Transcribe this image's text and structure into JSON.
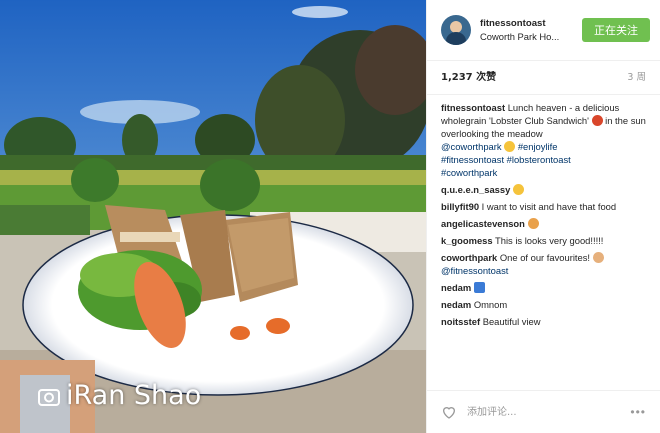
{
  "header": {
    "username": "fitnessontoast",
    "location": "Coworth Park Ho...",
    "follow_label": "正在关注"
  },
  "stats": {
    "likes": "1,237 次赞",
    "time_ago": "3 周"
  },
  "caption": {
    "user": "fitnessontoast",
    "text": "Lunch heaven - a delicious wholegrain 'Lobster Club Sandwich'",
    "text2": "in the sun overlooking the meadow",
    "mention": "@coworthpark",
    "tag1": "#enjoylife",
    "tag2": "#fitnessontoast",
    "tag3": "#lobsterontoast",
    "tag4": "#coworthpark"
  },
  "comments": [
    {
      "user": "q.u.e.e.n_sassy",
      "text": ""
    },
    {
      "user": "billyfit90",
      "text": "I want to visit and have that food"
    },
    {
      "user": "angelicastevenson",
      "text": ""
    },
    {
      "user": "k_goomess",
      "text": "This is looks very good!!!!!"
    },
    {
      "user": "coworthpark",
      "text": "One of our favourites!",
      "mention": "@fitnessontoast"
    },
    {
      "user": "nedam",
      "text": ""
    },
    {
      "user": "nedam",
      "text": "Omnom"
    },
    {
      "user": "noitsstef",
      "text": "Beautiful view"
    }
  ],
  "footer": {
    "placeholder": "添加评论...",
    "more": "•••"
  },
  "watermark": {
    "text": "iRan Shao"
  },
  "colors": {
    "follow_bg": "#70c050",
    "link": "#003569"
  },
  "icons": [
    "heart-icon",
    "more-icon",
    "emoji-icon",
    "camera-icon"
  ]
}
